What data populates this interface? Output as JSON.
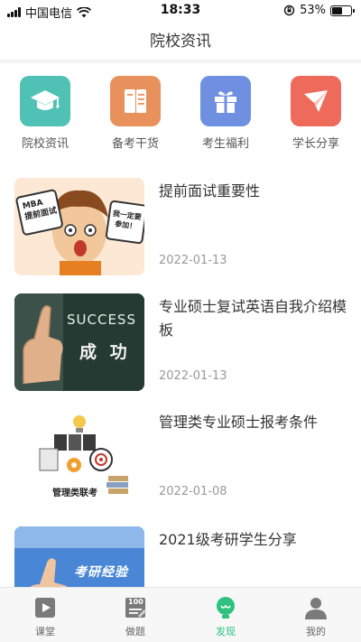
{
  "status_bar": {
    "carrier": "中国电信",
    "time": "18:33",
    "battery": "53%",
    "battery_level": 0.53
  },
  "header": {
    "title": "院校资讯"
  },
  "categories": [
    {
      "label": "院校资讯",
      "icon": "graduation-cap-icon",
      "color": "#4fc2b5"
    },
    {
      "label": "备考干货",
      "icon": "book-icon",
      "color": "#e8915d"
    },
    {
      "label": "考生福利",
      "icon": "gift-icon",
      "color": "#6f8fe0"
    },
    {
      "label": "学长分享",
      "icon": "paper-plane-icon",
      "color": "#ee6b5c"
    }
  ],
  "articles": [
    {
      "title": "提前面试重要性",
      "date": "2022-01-13",
      "thumb_texts": [
        "MBA\n提前面试",
        "我一定要\n参加！"
      ]
    },
    {
      "title": "专业硕士复试英语自我介绍模板",
      "date": "2022-01-13",
      "thumb_texts": [
        "SUCCESS",
        "成 功"
      ]
    },
    {
      "title": "管理类专业硕士报考条件",
      "date": "2022-01-08",
      "thumb_texts": [
        "管理类联考"
      ]
    },
    {
      "title": "2021级考研学生分享",
      "date": "",
      "thumb_texts": [
        "考研经验"
      ]
    }
  ],
  "tabbar": [
    {
      "label": "课堂",
      "icon": "video-icon",
      "active": false
    },
    {
      "label": "做题",
      "icon": "exercise-icon",
      "active": false,
      "badge": "100"
    },
    {
      "label": "发现",
      "icon": "lightbulb-icon",
      "active": true
    },
    {
      "label": "我的",
      "icon": "person-icon",
      "active": false
    }
  ],
  "colors": {
    "accent": "#2ec27e"
  }
}
